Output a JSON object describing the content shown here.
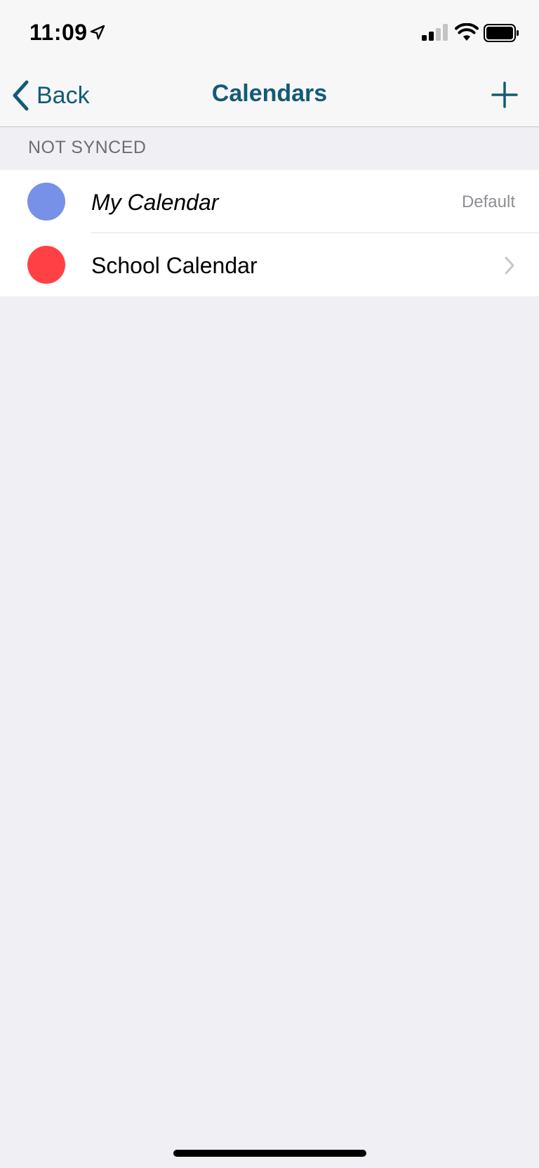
{
  "status_bar": {
    "time": "11:09",
    "icons": [
      "location-arrow-icon",
      "cellular-signal-icon",
      "wifi-icon",
      "battery-icon"
    ]
  },
  "nav": {
    "back_label": "Back",
    "title": "Calendars",
    "add_icon": "plus-icon",
    "accent_color": "#135a78"
  },
  "section": {
    "header": "NOT SYNCED"
  },
  "calendars": [
    {
      "name": "My Calendar",
      "meta": "Default",
      "color": "#7891e8",
      "italic": true
    },
    {
      "name": "School Calendar",
      "meta": "",
      "color": "#ff4146",
      "italic": false,
      "accessory": "chevron-right-icon"
    }
  ]
}
